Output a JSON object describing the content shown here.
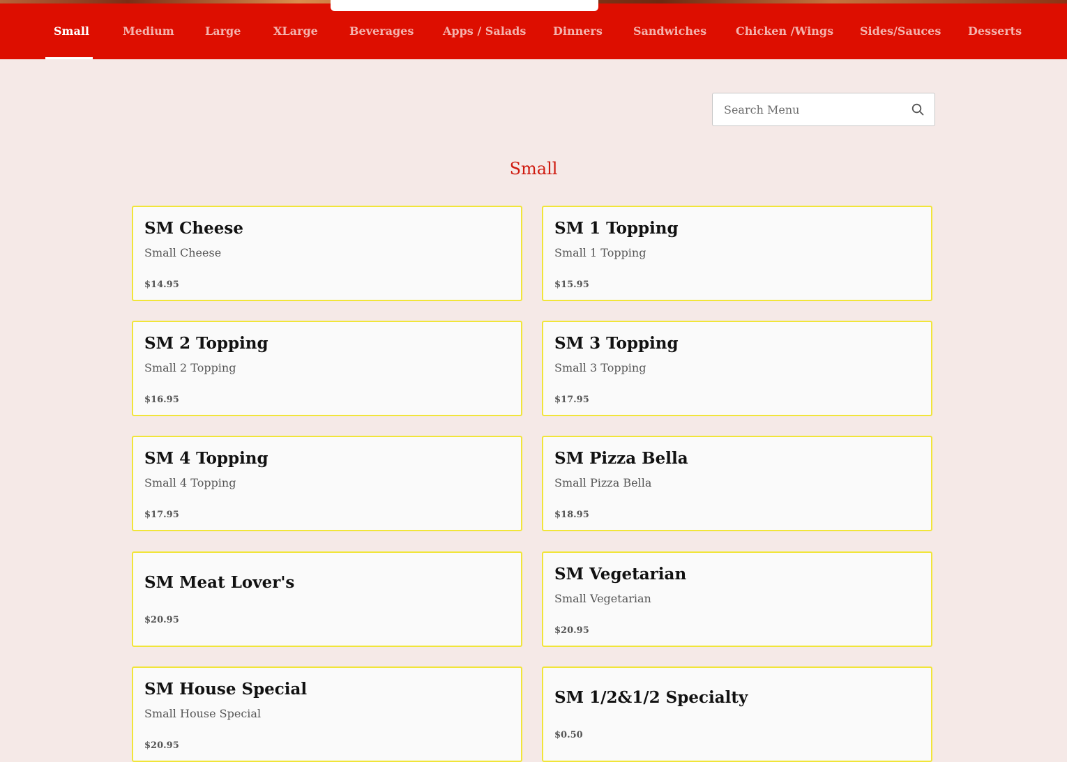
{
  "nav": {
    "items": [
      {
        "label": "Small",
        "active": true
      },
      {
        "label": "Medium"
      },
      {
        "label": "Large"
      },
      {
        "label": "XLarge"
      },
      {
        "label": "Beverages"
      },
      {
        "label": "Apps / Salads"
      },
      {
        "label": "Dinners"
      },
      {
        "label": "Sandwiches"
      },
      {
        "label": "Chicken /Wings"
      },
      {
        "label": "Sides/Sauces"
      },
      {
        "label": "Desserts"
      }
    ]
  },
  "search": {
    "placeholder": "Search Menu",
    "value": "",
    "icon": "search-icon"
  },
  "section": {
    "title": "Small"
  },
  "items": [
    {
      "name": "SM Cheese",
      "description": "Small Cheese",
      "price": "$14.95"
    },
    {
      "name": "SM 1 Topping",
      "description": "Small 1 Topping",
      "price": "$15.95"
    },
    {
      "name": "SM 2 Topping",
      "description": "Small 2 Topping",
      "price": "$16.95"
    },
    {
      "name": "SM 3 Topping",
      "description": "Small 3 Topping",
      "price": "$17.95"
    },
    {
      "name": "SM 4 Topping",
      "description": "Small 4 Topping",
      "price": "$17.95"
    },
    {
      "name": "SM Pizza Bella",
      "description": "Small Pizza Bella",
      "price": "$18.95"
    },
    {
      "name": "SM Meat Lover's",
      "description": "",
      "price": "$20.95"
    },
    {
      "name": "SM Vegetarian",
      "description": "Small Vegetarian",
      "price": "$20.95"
    },
    {
      "name": "SM House Special",
      "description": "Small House Special",
      "price": "$20.95"
    },
    {
      "name": "SM 1/2&1/2 Specialty",
      "description": "",
      "price": "$0.50"
    }
  ],
  "colors": {
    "nav_bg": "#dd0e00",
    "nav_text": "#f4b3ad",
    "nav_active": "#ffffff",
    "accent": "#cf1a0f",
    "card_border": "#f1e53a",
    "page_bg": "#f5e9e7"
  }
}
